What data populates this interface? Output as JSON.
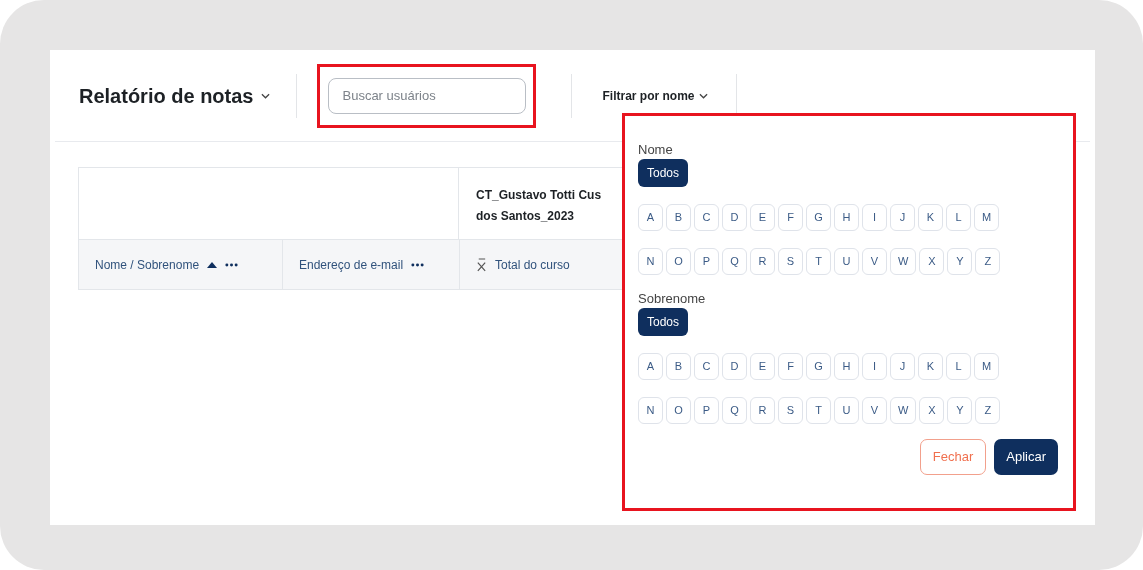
{
  "header": {
    "title": "Relatório de notas",
    "search": {
      "placeholder": "Buscar usuários"
    },
    "filter_label": "Filtrar por nome"
  },
  "table": {
    "group_header": "CT_Gustavo Totti Cus dos Santos_2023",
    "columns": [
      {
        "label": "Nome / Sobrenome",
        "sorted": true,
        "kind": "menu"
      },
      {
        "label": "Endereço de e-mail",
        "sorted": false,
        "kind": "menu"
      },
      {
        "label": "Total do curso",
        "sorted": false,
        "kind": "total"
      }
    ]
  },
  "filter_panel": {
    "groups": [
      {
        "label": "Nome",
        "all": {
          "label": "Todos",
          "selected": true
        },
        "letters": [
          {
            "label": "A",
            "selected": false
          },
          {
            "label": "B",
            "selected": false
          },
          {
            "label": "C",
            "selected": false
          },
          {
            "label": "D",
            "selected": false
          },
          {
            "label": "E",
            "selected": false
          },
          {
            "label": "F",
            "selected": false
          },
          {
            "label": "G",
            "selected": false
          },
          {
            "label": "H",
            "selected": false
          },
          {
            "label": "I",
            "selected": false
          },
          {
            "label": "J",
            "selected": false
          },
          {
            "label": "K",
            "selected": false
          },
          {
            "label": "L",
            "selected": false
          },
          {
            "label": "M",
            "selected": false
          },
          {
            "label": "N",
            "selected": false
          },
          {
            "label": "O",
            "selected": false
          },
          {
            "label": "P",
            "selected": false
          },
          {
            "label": "Q",
            "selected": false
          },
          {
            "label": "R",
            "selected": false
          },
          {
            "label": "S",
            "selected": false
          },
          {
            "label": "T",
            "selected": false
          },
          {
            "label": "U",
            "selected": false
          },
          {
            "label": "V",
            "selected": false
          },
          {
            "label": "W",
            "selected": false
          },
          {
            "label": "X",
            "selected": false
          },
          {
            "label": "Y",
            "selected": false
          },
          {
            "label": "Z",
            "selected": false
          }
        ]
      },
      {
        "label": "Sobrenome",
        "all": {
          "label": "Todos",
          "selected": true
        },
        "letters": [
          {
            "label": "A",
            "selected": false
          },
          {
            "label": "B",
            "selected": false
          },
          {
            "label": "C",
            "selected": false
          },
          {
            "label": "D",
            "selected": false
          },
          {
            "label": "E",
            "selected": false
          },
          {
            "label": "F",
            "selected": false
          },
          {
            "label": "G",
            "selected": false
          },
          {
            "label": "H",
            "selected": false
          },
          {
            "label": "I",
            "selected": false
          },
          {
            "label": "J",
            "selected": false
          },
          {
            "label": "K",
            "selected": false
          },
          {
            "label": "L",
            "selected": false
          },
          {
            "label": "M",
            "selected": false
          },
          {
            "label": "N",
            "selected": false
          },
          {
            "label": "O",
            "selected": false
          },
          {
            "label": "P",
            "selected": false
          },
          {
            "label": "Q",
            "selected": false
          },
          {
            "label": "R",
            "selected": false
          },
          {
            "label": "S",
            "selected": false
          },
          {
            "label": "T",
            "selected": false
          },
          {
            "label": "U",
            "selected": false
          },
          {
            "label": "V",
            "selected": false
          },
          {
            "label": "W",
            "selected": false
          },
          {
            "label": "X",
            "selected": false
          },
          {
            "label": "Y",
            "selected": false
          },
          {
            "label": "Z",
            "selected": false
          }
        ]
      }
    ],
    "buttons": [
      {
        "label": "Fechar",
        "kind": "secondary"
      },
      {
        "label": "Aplicar",
        "kind": "primary"
      }
    ]
  }
}
